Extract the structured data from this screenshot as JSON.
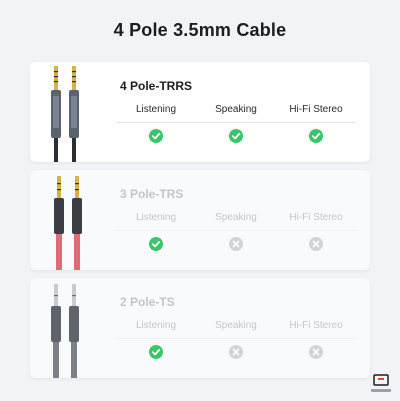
{
  "title": "4 Pole 3.5mm Cable",
  "columns": [
    "Listening",
    "Speaking",
    "Hi-Fi Stereo"
  ],
  "colors": {
    "check": "#3cc66a",
    "cross": "#d0d4d9",
    "cable_black": "#2b2e33",
    "cable_red": "#e06a75",
    "cable_gray": "#7c8187",
    "gold": "#d8b14a",
    "silver": "#c8cbd0"
  },
  "rows": [
    {
      "label": "4 Pole-TRRS",
      "support": [
        true,
        true,
        true
      ],
      "active": true,
      "plug": "gold",
      "cable": "black"
    },
    {
      "label": "3 Pole-TRS",
      "support": [
        true,
        false,
        false
      ],
      "active": false,
      "plug": "gold",
      "cable": "red"
    },
    {
      "label": "2 Pole-TS",
      "support": [
        true,
        false,
        false
      ],
      "active": false,
      "plug": "silver",
      "cable": "gray"
    }
  ]
}
